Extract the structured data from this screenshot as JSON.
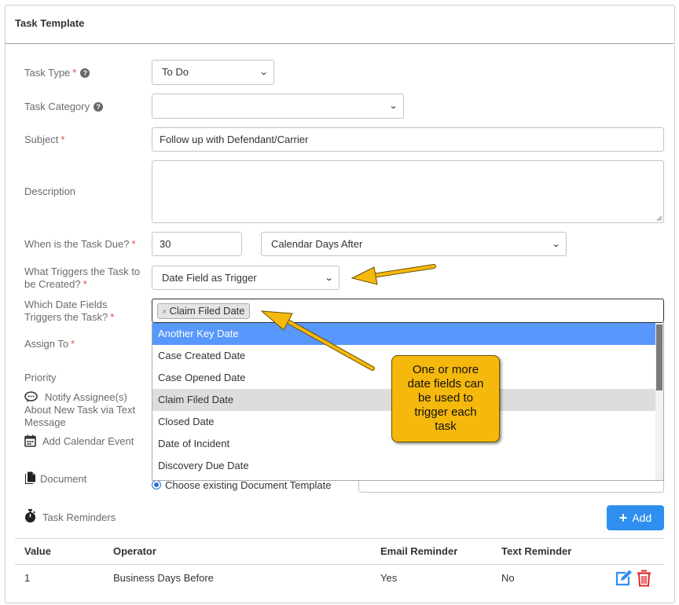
{
  "panel": {
    "title": "Task Template"
  },
  "form": {
    "task_type": {
      "label": "Task Type",
      "required": "*",
      "help": "?",
      "value": "To Do"
    },
    "task_category": {
      "label": "Task Category",
      "help": "?",
      "value": ""
    },
    "subject": {
      "label": "Subject",
      "required": "*",
      "value": "Follow up with Defendant/Carrier"
    },
    "description": {
      "label": "Description",
      "value": ""
    },
    "due": {
      "label": "When is the Task Due?",
      "required": "*",
      "amount": "30",
      "unit": "Calendar Days After"
    },
    "trigger": {
      "label_line1": "What Triggers the Task to",
      "label_line2": "be Created?",
      "required": "*",
      "value": "Date Field as Trigger"
    },
    "date_fields": {
      "label_line1": "Which Date Fields",
      "label_line2": "Triggers the Task?",
      "required": "*",
      "selected_tag": "Claim Filed Date",
      "tag_remove": "×",
      "options": [
        "Another Key Date",
        "Case Created Date",
        "Case Opened Date",
        "Claim Filed Date",
        "Closed Date",
        "Date of Incident",
        "Discovery Due Date"
      ],
      "highlighted_option": "Another Key Date",
      "selected_option": "Claim Filed Date"
    },
    "assign_to": {
      "label": "Assign To",
      "required": "*"
    },
    "priority": {
      "label": "Priority"
    },
    "notify": {
      "line1": "Notify Assignee(s)",
      "line2": "About New Task via Text",
      "line3": "Message"
    },
    "calendar": {
      "label": "Add Calendar Event"
    },
    "document": {
      "label": "Document",
      "radio_label": "Choose existing Document Template"
    }
  },
  "callout": {
    "lines": [
      "One or more",
      "date fields can",
      "be used to",
      "trigger each",
      "task"
    ],
    "color": "#f5b80c"
  },
  "reminders": {
    "title": "Task Reminders",
    "add_label": "Add",
    "columns": [
      "Value",
      "Operator",
      "Email Reminder",
      "Text Reminder"
    ],
    "rows": [
      {
        "value": "1",
        "operator": "Business Days Before",
        "email": "Yes",
        "text": "No"
      }
    ]
  },
  "colors": {
    "accent": "#2f8ff0",
    "highlight": "#5897fb",
    "required": "#e0493f",
    "delete": "#e0282e",
    "arrow": "#f5b80c"
  },
  "icons": [
    "help-icon",
    "chevron-down-icon",
    "chat-icon",
    "calendar-icon",
    "document-icon",
    "stopwatch-icon",
    "plus-icon",
    "edit-icon",
    "trash-icon",
    "arrow-icon"
  ]
}
